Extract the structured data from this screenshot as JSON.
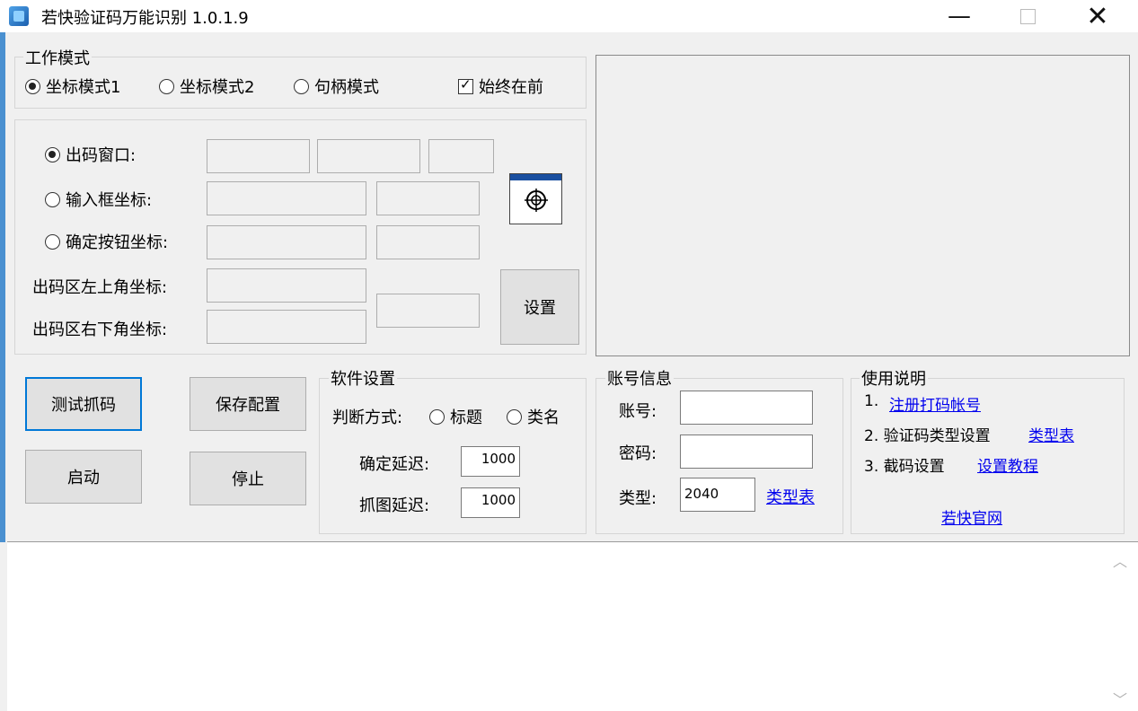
{
  "window": {
    "title": "若快验证码万能识别 1.0.1.9",
    "minimize": "—",
    "close": "✕"
  },
  "work_mode": {
    "title": "工作模式",
    "options": [
      "坐标模式1",
      "坐标模式2",
      "句柄模式"
    ],
    "selected": "坐标模式1",
    "always_on_top": {
      "label": "始终在前",
      "checked": true
    }
  },
  "coords": {
    "output_window": "出码窗口:",
    "input_box": "输入框坐标:",
    "confirm_button": "确定按钮坐标:",
    "top_left": "出码区左上角坐标:",
    "bottom_right": "出码区右下角坐标:",
    "selected": "出码窗口:",
    "set_button": "设置"
  },
  "buttons": {
    "test_capture": "测试抓码",
    "save_config": "保存配置",
    "start": "启动",
    "stop": "停止"
  },
  "software_settings": {
    "title": "软件设置",
    "judge_label": "判断方式:",
    "judge_options": [
      "标题",
      "类名"
    ],
    "confirm_delay_label": "确定延迟:",
    "confirm_delay": "1000",
    "capture_delay_label": "抓图延迟:",
    "capture_delay": "1000"
  },
  "account": {
    "title": "账号信息",
    "account_label": "账号:",
    "account_value": "",
    "password_label": "密码:",
    "password_value": "",
    "type_label": "类型:",
    "type_value": "2040",
    "type_link": "类型表"
  },
  "instructions": {
    "title": "使用说明",
    "item1_prefix": "1.",
    "item1_link": "注册打码帐号",
    "item2_prefix": "2. 验证码类型设置",
    "item2_link": "类型表",
    "item3_prefix": "3. 截码设置",
    "item3_link": "设置教程",
    "website_link": "若快官网"
  },
  "log": {
    "content": ""
  },
  "colors": {
    "link": "#0000ee",
    "focus_border": "#0078d7",
    "title_icon": "#1b5fae"
  },
  "icons": [
    "app-icon",
    "minimize-icon",
    "maximize-icon",
    "close-icon",
    "crosshair-icon",
    "scroll-up-icon",
    "scroll-down-icon"
  ]
}
